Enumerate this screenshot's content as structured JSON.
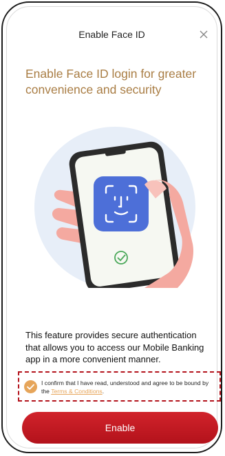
{
  "header": {
    "title": "Enable Face ID",
    "close_icon": "close-icon"
  },
  "headline": "Enable Face ID login for greater convenience and security",
  "description": "This feature provides secure authentication that allows you to access our Mobile Banking app in a more convenient manner.",
  "consent": {
    "checked": true,
    "text_before": "I confirm that I have read, understood and agree to be bound by the ",
    "link_text": "Terms & Conditions",
    "text_after": "."
  },
  "enable_button": {
    "label": "Enable"
  },
  "colors": {
    "accent": "#a97d44",
    "checkbox": "#e6a55a",
    "button": "#c8161f",
    "illustration_bg": "#e7eef8",
    "faceid_tile": "#4d6fd8"
  }
}
